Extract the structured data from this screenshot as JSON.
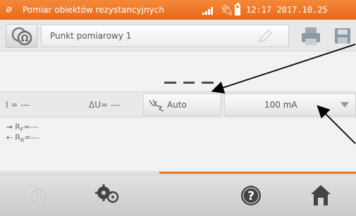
{
  "status_bar": {
    "title": "Pomiar obiektów rezystancyjnych",
    "time": "12:17",
    "date": "2017.10.25",
    "accent_color": "#e87927"
  },
  "header": {
    "point_name": "Punkt pomiarowy 1",
    "icons": [
      "meter-icon",
      "pencil-icon",
      "print-icon",
      "save-icon"
    ]
  },
  "main_result": {
    "value": "---"
  },
  "params": {
    "current": "I = ---",
    "voltage_drop": "ΔU= ---",
    "mode_label": "Auto",
    "test_current": "100 mA"
  },
  "sub_results": {
    "rf_label": "R",
    "rf_sub": "F",
    "rf_value": "=---",
    "rr_label": "R",
    "rr_sub": "R",
    "rr_value": "=---"
  },
  "toolbar": {
    "icons": [
      "meter-icon",
      "settings-icon",
      "help-icon",
      "home-icon"
    ]
  }
}
